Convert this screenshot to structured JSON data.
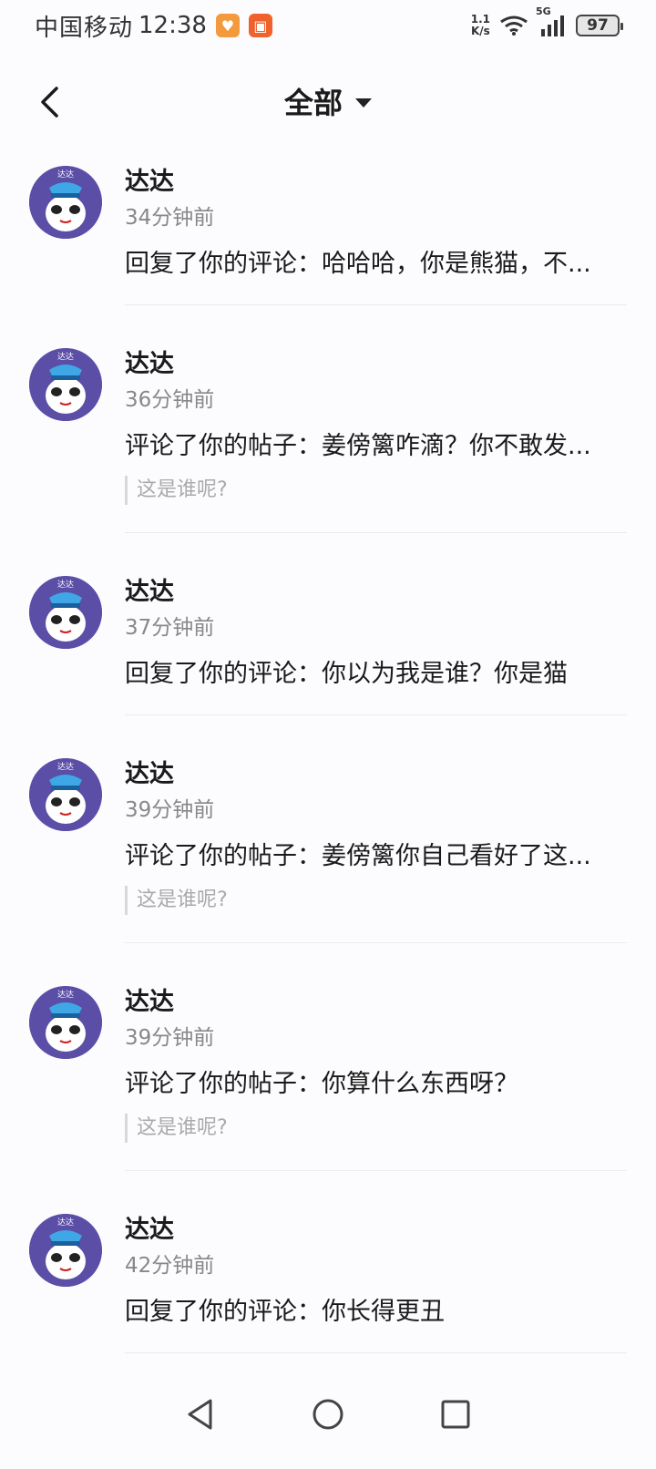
{
  "status_bar": {
    "carrier": "中国移动",
    "time": "12:38",
    "net_speed_value": "1.1",
    "net_speed_unit": "K/s",
    "signal_label": "5G",
    "battery": "97"
  },
  "header": {
    "title": "全部"
  },
  "notifications": [
    {
      "name": "达达",
      "time": "34分钟前",
      "content": "回复了你的评论：哈哈哈，你是熊猫，不...",
      "quote": ""
    },
    {
      "name": "达达",
      "time": "36分钟前",
      "content": "评论了你的帖子：姜傍篱咋滴？你不敢发...",
      "quote": "这是谁呢?"
    },
    {
      "name": "达达",
      "time": "37分钟前",
      "content": "回复了你的评论：你以为我是谁？你是猫",
      "quote": ""
    },
    {
      "name": "达达",
      "time": "39分钟前",
      "content": "评论了你的帖子：姜傍篱你自己看好了这...",
      "quote": "这是谁呢?"
    },
    {
      "name": "达达",
      "time": "39分钟前",
      "content": "评论了你的帖子：你算什么东西呀？",
      "quote": "这是谁呢?"
    },
    {
      "name": "达达",
      "time": "42分钟前",
      "content": "回复了你的评论：你长得更丑",
      "quote": ""
    }
  ],
  "colors": {
    "avatar_bg": "#5b4ea6",
    "background": "#fcfbfe"
  }
}
